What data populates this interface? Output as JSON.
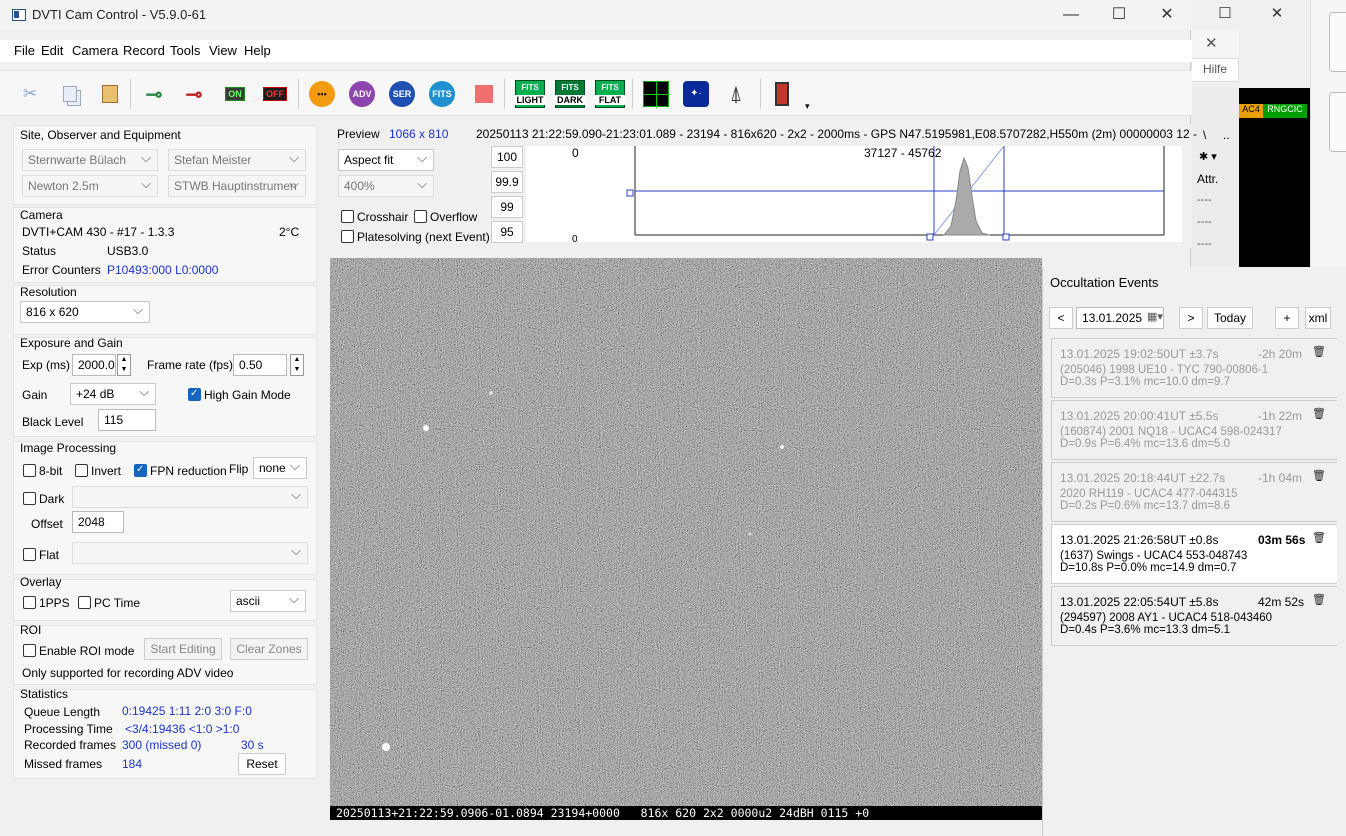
{
  "window": {
    "title": "DVTI Cam Control - V5.9.0-61",
    "minimize": "—",
    "maximize": "☐",
    "close": "✕"
  },
  "background_window": {
    "maximize": "☐",
    "close": "✕",
    "close2": "✕",
    "hilfe": "Hilfe",
    "tag1": "AC4",
    "tag2": "RNGCIC",
    "backslash": "\\",
    "dots": "..",
    "attr": "Attr.",
    "dash1": "----",
    "dash2": "----",
    "dash3": "----"
  },
  "menu": [
    "File",
    "Edit",
    "Camera",
    "Record",
    "Tools",
    "View",
    "Help"
  ],
  "toolbar": {
    "adv": "ADV",
    "ser": "SER",
    "fits": "FITS",
    "on": "ON",
    "off": "OFF",
    "fits_label": "FITS",
    "light": "LIGHT",
    "dark": "DARK",
    "flat": "FLAT"
  },
  "site": {
    "header": "Site, Observer and Equipment",
    "site": "Sternwarte Bülach",
    "observer": "Stefan Meister",
    "telescope": "Newton 2.5m",
    "instrument": "STWB Hauptinstrumen"
  },
  "camera": {
    "header": "Camera",
    "model": "DVTI+CAM 430  -  #17  -  1.3.3",
    "temp": "2°C",
    "status_label": "Status",
    "status_value": "USB3.0",
    "err_label": "Error Counters",
    "err_value": "P10493:000 L0:0000"
  },
  "resolution": {
    "header": "Resolution",
    "value": "816 x 620"
  },
  "exposure": {
    "header": "Exposure and Gain",
    "exp_label": "Exp (ms)",
    "exp_value": "2000.0",
    "rate_label": "Frame rate (fps)",
    "rate_value": "0.50",
    "gain_label": "Gain",
    "gain_value": "+24 dB",
    "high_gain": "High Gain Mode",
    "black_label": "Black Level",
    "black_value": "115"
  },
  "processing": {
    "header": "Image Processing",
    "bit8": "8-bit",
    "invert": "Invert",
    "fpn": "FPN reduction",
    "flip_label": "Flip",
    "flip_value": "none",
    "dark": "Dark",
    "offset_label": "Offset",
    "offset_value": "2048",
    "flat": "Flat"
  },
  "overlay": {
    "header": "Overlay",
    "pps": "1PPS",
    "pctime": "PC Time",
    "format": "ascii"
  },
  "roi": {
    "header": "ROI",
    "enable": "Enable ROI mode",
    "start": "Start Editing",
    "clear": "Clear Zones",
    "note": "Only supported for recording ADV video"
  },
  "statistics": {
    "header": "Statistics",
    "queue_label": "Queue Length",
    "queue_value": "0:19425  1:11  2:0  3:0  F:0",
    "proc_label": "Processing Time",
    "proc_value": "<3/4:19436 <1:0  >1:0",
    "rec_label": "Recorded frames",
    "rec_value": "300 (missed 0)",
    "rec_time": "30 s",
    "missed_label": "Missed frames",
    "missed_value": "184",
    "reset": "Reset"
  },
  "preview": {
    "label": "Preview",
    "size": "1066 x 810",
    "info": "20250113 21:22:59.090-21:23:01.089 - 23194 - 816x620 - 2x2 - 2000ms - GPS N47.5195981,E08.5707282,H550m (2m) 00000003 12 -",
    "fit": "Aspect fit",
    "zoom": "400%",
    "crosshair": "Crosshair",
    "overflow": "Overflow",
    "platesolving": "Platesolving (next Event)",
    "p100": "100",
    "p999": "99.9",
    "p99": "99",
    "p95": "95",
    "hist_top": "0",
    "hist_bottom": "0",
    "hist_range": "37127 - 45762"
  },
  "cam_overlay": "20250113+21:22:59.0906-01.0894 23194+0000   816x 620 2x2 0000u2 24dBH 0115 +0",
  "occultation": {
    "title": "Occultation Events",
    "prev": "<",
    "date": "13.01.2025",
    "next": ">",
    "today": "Today",
    "add": "+",
    "xml": "xml",
    "events": [
      {
        "time": "13.01.2025 19:02:50UT ±3.7s",
        "rel": "-2h 20m",
        "obj": "(205046) 1998 UE10 - TYC 790-00806-1",
        "params": "D=0.3s  P=3.1%  mc=10.0  dm=9.7"
      },
      {
        "time": "13.01.2025 20:00:41UT ±5.5s",
        "rel": "-1h 22m",
        "obj": "(160874) 2001 NQ18 - UCAC4 598-024317",
        "params": "D=0.9s  P=6.4%  mc=13.6  dm=5.0"
      },
      {
        "time": "13.01.2025 20:18:44UT ±22.7s",
        "rel": "-1h 04m",
        "obj": "2020 RH119 - UCAC4 477-044315",
        "params": "D=0.2s  P=0.6%  mc=13.7  dm=8.6"
      },
      {
        "time": "13.01.2025 21:26:58UT ±0.8s",
        "rel": "03m 56s",
        "obj": "(1637) Swings - UCAC4 553-048743",
        "params": "D=10.8s  P=0.0%  mc=14.9  dm=0.7"
      },
      {
        "time": "13.01.2025 22:05:54UT ±5.8s",
        "rel": "42m 52s",
        "obj": "(294597) 2008 AY1 - UCAC4 518-043460",
        "params": "D=0.4s  P=3.6%  mc=13.3  dm=5.1"
      }
    ]
  }
}
